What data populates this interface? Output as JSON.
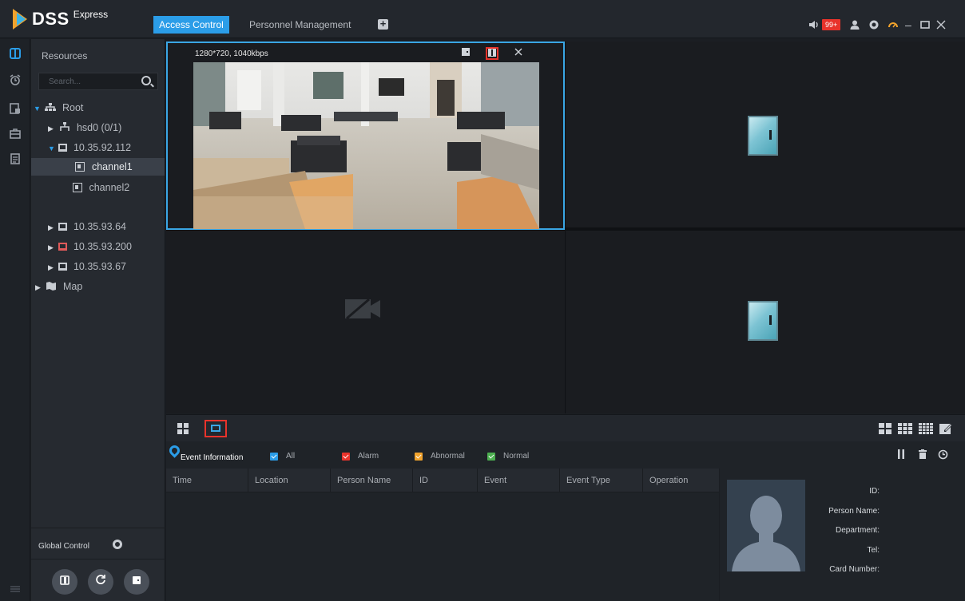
{
  "app": {
    "logo_text": "DSS",
    "logo_sub": "Express"
  },
  "tabs": [
    {
      "label": "Access Control"
    },
    {
      "label": "Personnel Management"
    }
  ],
  "topbar": {
    "alarm_badge": "99+"
  },
  "sidebar": {
    "title": "Resources"
  },
  "search": {
    "placeholder": "Search..."
  },
  "tree": [
    {
      "label": "Root"
    },
    {
      "label": "hsd0 (0/1)"
    },
    {
      "label": "10.35.92.112"
    },
    {
      "label": "channel1"
    },
    {
      "label": "channel2"
    },
    {
      "label": "10.35.93.64"
    },
    {
      "label": "10.35.93.200"
    },
    {
      "label": "10.35.93.67"
    },
    {
      "label": "Map"
    }
  ],
  "global_control": {
    "label": "Global Control"
  },
  "video": {
    "stream_info": "1280*720, 1040kbps"
  },
  "events": {
    "title": "Event Information",
    "filters": [
      {
        "label": "All",
        "color": "#2b9de8"
      },
      {
        "label": "Alarm",
        "color": "#e8332b"
      },
      {
        "label": "Abnormal",
        "color": "#f0a22c"
      },
      {
        "label": "Normal",
        "color": "#4caf50"
      }
    ],
    "columns": [
      "Time",
      "Location",
      "Person Name",
      "ID",
      "Event",
      "Event Type",
      "Operation"
    ]
  },
  "person": {
    "fields": [
      "ID:",
      "Person Name:",
      "Department:",
      "Tel:",
      "Card Number:"
    ]
  }
}
